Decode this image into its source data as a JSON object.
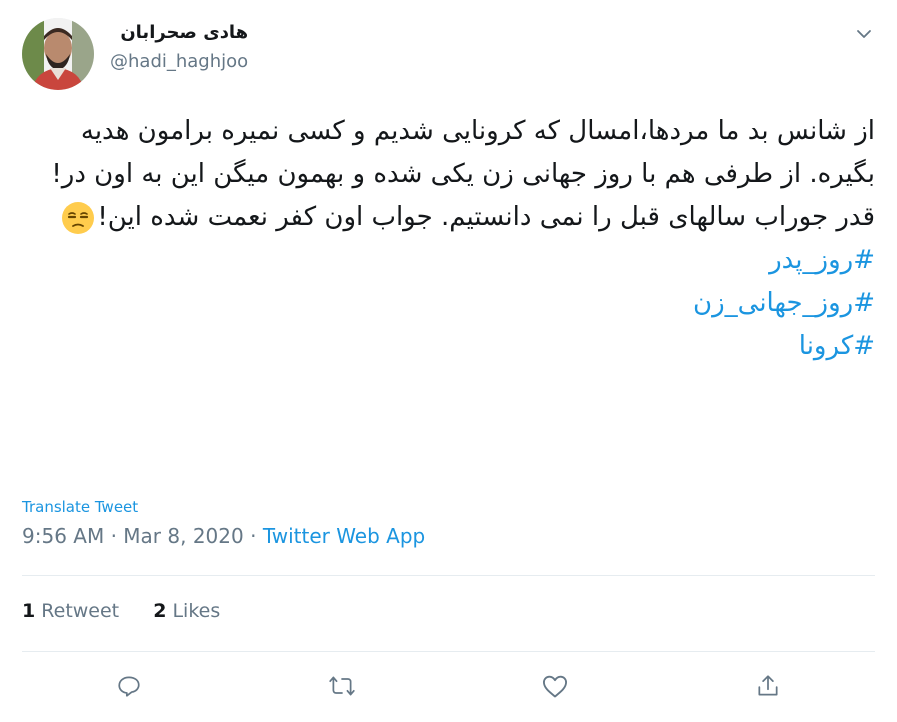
{
  "user": {
    "display_name": "هادی صحرابان",
    "handle": "@hadi_haghjoo"
  },
  "tweet": {
    "line1": "از شانس بد ما مردها،امسال که کرونایی شدیم و کسی نمیره برامون هدیه بگیره. از طرفی هم با روز جهانی زن یکی شده و بهمون میگن این به اون در!",
    "line2": "قدر جوراب سالهای قبل را نمی دانستیم. جواب اون کفر نعمت شده این!",
    "emoji": "unamused-face",
    "hashtags": [
      "#روز_پدر",
      "#روز_جهانی_زن",
      "#کرونا"
    ]
  },
  "translate_label": "Translate Tweet",
  "meta": {
    "time": "9:56 AM",
    "separator": " · ",
    "date": "Mar 8, 2020",
    "source": "Twitter Web App"
  },
  "stats": {
    "retweets_count": "1",
    "retweets_label": "Retweet",
    "likes_count": "2",
    "likes_label": "Likes"
  },
  "icons": [
    "chevron-down-icon",
    "reply-icon",
    "retweet-icon",
    "like-icon",
    "share-icon"
  ],
  "colors": {
    "link": "#1b95e0",
    "secondary_text": "#657786",
    "primary_text": "#14171a",
    "divider": "#e6ecf0"
  }
}
